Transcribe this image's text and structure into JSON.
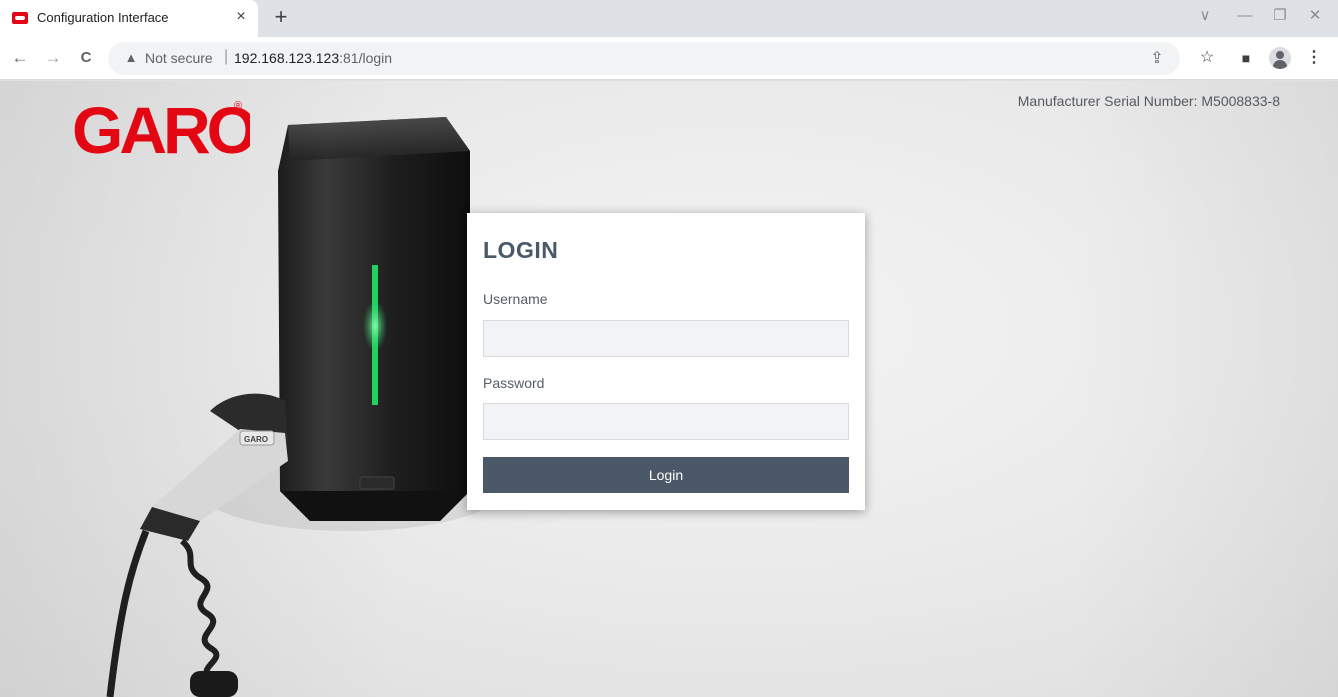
{
  "browser": {
    "tab": {
      "title": "Configuration Interface",
      "close_glyph": "×"
    },
    "new_tab_glyph": "+",
    "window_controls": {
      "dropdown": "∨",
      "minimize": "—",
      "restore": "❐",
      "close": "✕"
    },
    "nav": {
      "back": "←",
      "forward": "→",
      "reload": "C"
    },
    "omnibox": {
      "security_icon": "▲",
      "security_text": "Not secure",
      "separator": "|",
      "url_host": "192.168.123.123",
      "url_rest": ":81/login"
    },
    "toolbar_icons": {
      "share": "⇪",
      "bookmark": "☆",
      "side_panel": "■",
      "menu": "⋮"
    }
  },
  "page": {
    "logo_text": "GARO",
    "logo_registered": "®",
    "serial_text": "Manufacturer Serial Number: M5008833-8",
    "charger_badge": "GARO",
    "login": {
      "title": "LOGIN",
      "username_label": "Username",
      "username_value": "",
      "password_label": "Password",
      "password_value": "",
      "button_label": "Login"
    }
  },
  "colors": {
    "brand_red": "#e30613",
    "accent_slate": "#4a5868",
    "led_green": "#1fd160"
  }
}
